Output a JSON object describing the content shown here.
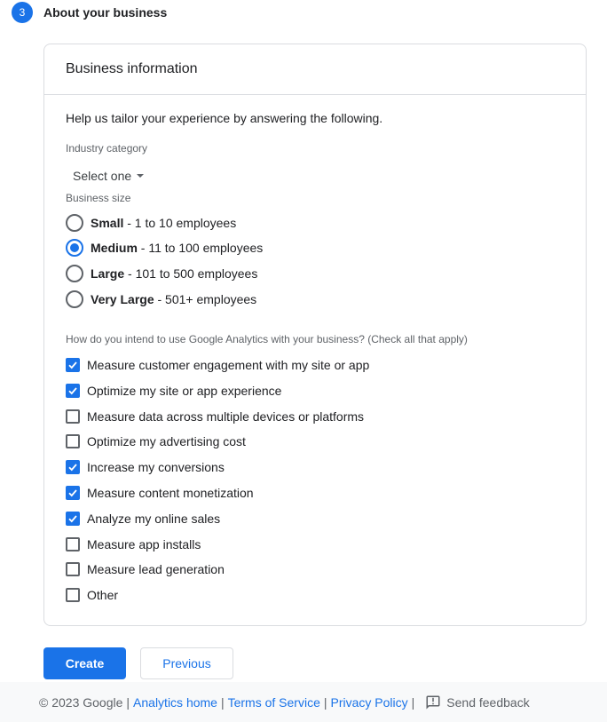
{
  "step": {
    "number": "3",
    "title": "About your business"
  },
  "card": {
    "title": "Business information",
    "intro": "Help us tailor your experience by answering the following.",
    "industry": {
      "label": "Industry category",
      "value": "Select one"
    },
    "business_size": {
      "label": "Business size",
      "options": [
        {
          "bold": "Small",
          "rest": " - 1 to 10 employees",
          "selected": false
        },
        {
          "bold": "Medium",
          "rest": " - 11 to 100 employees",
          "selected": true
        },
        {
          "bold": "Large",
          "rest": " - 101 to 500 employees",
          "selected": false
        },
        {
          "bold": "Very Large",
          "rest": " - 501+ employees",
          "selected": false
        }
      ]
    },
    "usage": {
      "label": "How do you intend to use Google Analytics with your business? (Check all that apply)",
      "options": [
        {
          "label": "Measure customer engagement with my site or app",
          "checked": true
        },
        {
          "label": "Optimize my site or app experience",
          "checked": true
        },
        {
          "label": "Measure data across multiple devices or platforms",
          "checked": false
        },
        {
          "label": "Optimize my advertising cost",
          "checked": false
        },
        {
          "label": "Increase my conversions",
          "checked": true
        },
        {
          "label": "Measure content monetization",
          "checked": true
        },
        {
          "label": "Analyze my online sales",
          "checked": true
        },
        {
          "label": "Measure app installs",
          "checked": false
        },
        {
          "label": "Measure lead generation",
          "checked": false
        },
        {
          "label": "Other",
          "checked": false
        }
      ]
    }
  },
  "buttons": {
    "create": "Create",
    "previous": "Previous"
  },
  "footer": {
    "copyright": "© 2023 Google",
    "links": [
      "Analytics home",
      "Terms of Service",
      "Privacy Policy"
    ],
    "feedback": "Send feedback"
  },
  "colors": {
    "accent": "#1a73e8",
    "border": "#dadce0",
    "footer_bg": "#f8f9fa"
  }
}
